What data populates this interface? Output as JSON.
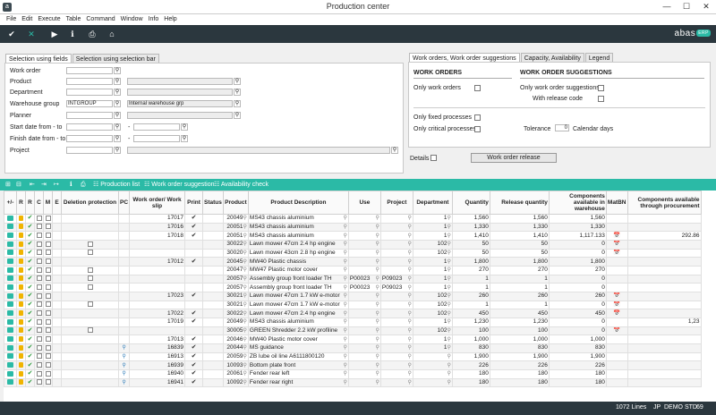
{
  "window": {
    "title": "Production center"
  },
  "menu": [
    "File",
    "Edit",
    "Execute",
    "Table",
    "Command",
    "Window",
    "Info",
    "Help"
  ],
  "toolbar": {
    "logo": "abas",
    "logo_badge": "ERP"
  },
  "left_tabs": [
    "Selection using fields",
    "Selection using selection bar"
  ],
  "fields": {
    "work_order": "Work order",
    "product": "Product",
    "department": "Department",
    "warehouse_group": "Warehouse group",
    "warehouse_group_value": "INTGROUP",
    "warehouse_group_desc": "Internal warehouse grp",
    "planner": "Planner",
    "start_date": "Start date from - to",
    "finish_date": "Finish date from - to",
    "project": "Project",
    "dash": "-"
  },
  "right_tabs": [
    "Work orders, Work order suggestions",
    "Capacity, Availability",
    "Legend"
  ],
  "options": {
    "work_orders_head": "WORK ORDERS",
    "suggestions_head": "WORK ORDER SUGGESTIONS",
    "only_work_orders": "Only work orders",
    "only_suggestions": "Only work order suggestions",
    "with_release_code": "With release code",
    "only_fixed": "Only fixed processes",
    "only_critical": "Only critical processes",
    "tolerance": "Tolerance",
    "tolerance_value": "0",
    "calendar_days": "Calendar days"
  },
  "details_label": "Details",
  "release_button": "Work order release",
  "actions": [
    "Production list",
    "Work order suggestion",
    "Availability check"
  ],
  "columns": [
    "+/-",
    "R",
    "R",
    "C",
    "M",
    "E",
    "Deletion protection",
    "PC",
    "Work order/ Work slip",
    "Print",
    "Status",
    "Product",
    "Product Description",
    "Use",
    "Project",
    "Department",
    "Quantity",
    "Release quantity",
    "Components available in warehouse",
    "MatBN",
    "Components available through procurement"
  ],
  "rows": [
    {
      "wo": "17017",
      "product": "20049",
      "desc": "MS43 chassis aluminium",
      "use": "",
      "project": "",
      "dept": "1",
      "qty": "1,560",
      "rel": "1,560",
      "comp": "1,560",
      "matbn": false,
      "proc": ""
    },
    {
      "wo": "17016",
      "product": "20051",
      "desc": "MS43 chassis aluminium",
      "use": "",
      "project": "",
      "dept": "1",
      "qty": "1,330",
      "rel": "1,330",
      "comp": "1,330",
      "matbn": false,
      "proc": ""
    },
    {
      "wo": "17018",
      "product": "20051",
      "desc": "MS43 chassis aluminium",
      "use": "",
      "project": "",
      "dept": "1",
      "qty": "1,410",
      "rel": "1,410",
      "comp": "1,117.133",
      "matbn": true,
      "proc": "292.86"
    },
    {
      "wo": "",
      "product": "30022",
      "desc": "Lawn mower 47cm 2.4 hp engine",
      "use": "",
      "project": "",
      "dept": "102",
      "qty": "50",
      "rel": "50",
      "comp": "0",
      "matbn": true,
      "proc": ""
    },
    {
      "wo": "",
      "product": "30020",
      "desc": "Lawn mower 43cm 2.8 hp engine",
      "use": "",
      "project": "",
      "dept": "102",
      "qty": "50",
      "rel": "50",
      "comp": "0",
      "matbn": true,
      "proc": ""
    },
    {
      "wo": "17012",
      "product": "20045",
      "desc": "MW40 Plastic chassis",
      "use": "",
      "project": "",
      "dept": "1",
      "qty": "1,800",
      "rel": "1,800",
      "comp": "1,800",
      "matbn": false,
      "proc": ""
    },
    {
      "wo": "",
      "product": "20047",
      "desc": "MW47 Plastic motor cover",
      "use": "",
      "project": "",
      "dept": "1",
      "qty": "270",
      "rel": "270",
      "comp": "270",
      "matbn": false,
      "proc": ""
    },
    {
      "wo": "",
      "product": "20057",
      "desc": "Assembly group front loader TH",
      "use": "P00023",
      "project": "P09023",
      "dept": "1",
      "qty": "1",
      "rel": "1",
      "comp": "0",
      "matbn": false,
      "proc": ""
    },
    {
      "wo": "",
      "product": "20057",
      "desc": "Assembly group front loader TH",
      "use": "P00023",
      "project": "P09023",
      "dept": "1",
      "qty": "1",
      "rel": "1",
      "comp": "0",
      "matbn": false,
      "proc": ""
    },
    {
      "wo": "17023",
      "product": "30021",
      "desc": "Lawn mower 47cm 1.7 kW e-motor",
      "use": "",
      "project": "",
      "dept": "102",
      "qty": "260",
      "rel": "260",
      "comp": "260",
      "matbn": true,
      "proc": ""
    },
    {
      "wo": "",
      "product": "30021",
      "desc": "Lawn mower 47cm 1.7 kW e-motor",
      "use": "",
      "project": "",
      "dept": "102",
      "qty": "1",
      "rel": "1",
      "comp": "0",
      "matbn": true,
      "proc": ""
    },
    {
      "wo": "17022",
      "product": "30022",
      "desc": "Lawn mower 47cm 2.4 hp engine",
      "use": "",
      "project": "",
      "dept": "102",
      "qty": "450",
      "rel": "450",
      "comp": "450",
      "matbn": true,
      "proc": ""
    },
    {
      "wo": "17019",
      "product": "20049",
      "desc": "MS43 chassis aluminium",
      "use": "",
      "project": "",
      "dept": "1",
      "qty": "1,230",
      "rel": "1,230",
      "comp": "0",
      "matbn": false,
      "proc": "1,23"
    },
    {
      "wo": "",
      "product": "30005",
      "desc": "GREEN Shredder 2.2 kW profiline",
      "use": "",
      "project": "",
      "dept": "102",
      "qty": "100",
      "rel": "100",
      "comp": "0",
      "matbn": true,
      "proc": ""
    },
    {
      "wo": "17013",
      "product": "20046",
      "desc": "MW40 Plastic motor cover",
      "use": "",
      "project": "",
      "dept": "1",
      "qty": "1,000",
      "rel": "1,000",
      "comp": "1,000",
      "matbn": false,
      "proc": ""
    },
    {
      "wo": "16839",
      "product": "20044",
      "desc": "MS guidance",
      "use": "",
      "project": "",
      "dept": "1",
      "qty": "830",
      "rel": "830",
      "comp": "830",
      "matbn": false,
      "proc": ""
    },
    {
      "wo": "16913",
      "product": "20059",
      "desc": "ZB lube oil line A6111800120",
      "use": "",
      "project": "",
      "dept": "",
      "qty": "1,900",
      "rel": "1,900",
      "comp": "1,900",
      "matbn": false,
      "proc": ""
    },
    {
      "wo": "16939",
      "product": "10093",
      "desc": "Bottom plate front",
      "use": "",
      "project": "",
      "dept": "",
      "qty": "226",
      "rel": "226",
      "comp": "226",
      "matbn": false,
      "proc": ""
    },
    {
      "wo": "16940",
      "product": "20061",
      "desc": "Fender rear left",
      "use": "",
      "project": "",
      "dept": "",
      "qty": "180",
      "rel": "180",
      "comp": "180",
      "matbn": false,
      "proc": ""
    },
    {
      "wo": "16941",
      "product": "10092",
      "desc": "Fender rear right",
      "use": "",
      "project": "",
      "dept": "",
      "qty": "180",
      "rel": "180",
      "comp": "180",
      "matbn": false,
      "proc": ""
    }
  ],
  "status": {
    "lines": "1072 Lines",
    "lang": "JP",
    "client": "DEMO STD",
    "num": "69"
  }
}
